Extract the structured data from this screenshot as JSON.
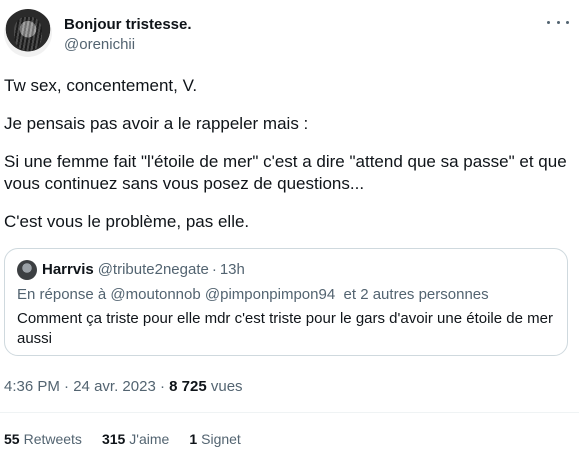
{
  "tweet": {
    "author": {
      "display_name": "Bonjour tristesse.",
      "handle": "@orenichii"
    },
    "more_icon": "more-horizontal-icon",
    "paragraphs": [
      "Tw sex, concentement, V.",
      "Je pensais pas avoir a le rappeler mais :",
      "Si une femme fait \"l'étoile de mer\" c'est a dire \"attend que sa passe\" et que vous continuez sans vous posez de questions...",
      "C'est vous le problème, pas elle."
    ],
    "quote": {
      "display_name": "Harrvis",
      "handle": "@tribute2negate",
      "separator": "·",
      "time": "13h",
      "reply_prefix": "En réponse à",
      "reply_mention_1": "@moutonnob",
      "reply_mention_2": "@pimponpimpon94",
      "reply_suffix": "et 2 autres personnes",
      "text": "Comment ça triste pour elle mdr c'est triste pour le gars d'avoir une étoile de mer aussi"
    },
    "meta": {
      "time": "4:36 PM",
      "separator": "·",
      "date": "24 avr. 2023",
      "views_count": "8 725",
      "views_label": "vues"
    },
    "stats": {
      "retweets_count": "55",
      "retweets_label": "Retweets",
      "likes_count": "315",
      "likes_label": "J'aime",
      "bookmarks_count": "1",
      "bookmarks_label": "Signet"
    }
  }
}
